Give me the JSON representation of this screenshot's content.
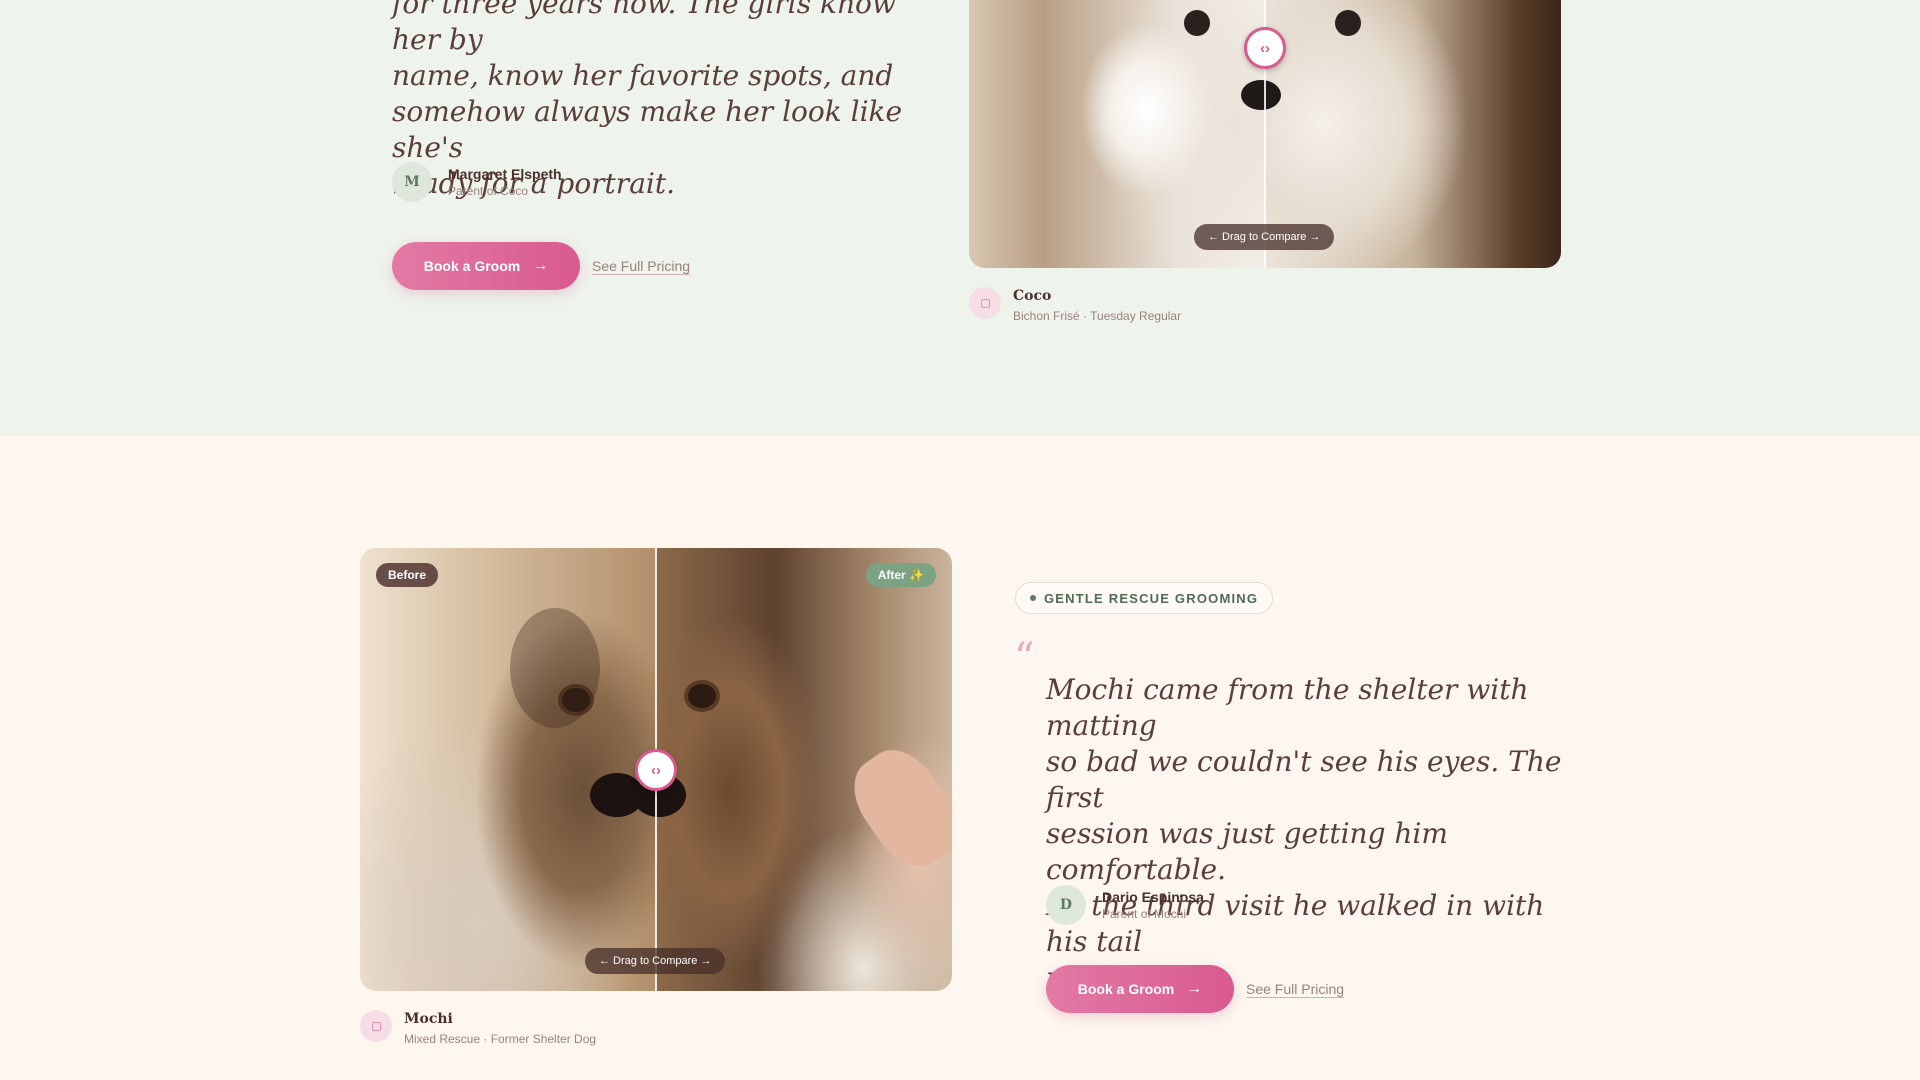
{
  "top": {
    "quote_lines": [
      "for three years now. The girls know her by",
      "name, know her favorite spots, and",
      "somehow always make her look like she's",
      "ready for a portrait."
    ],
    "author": {
      "initial": "M",
      "name": "Margaret Elspeth",
      "role": "Parent of Coco"
    },
    "cta": {
      "book_label": "Book a Groom",
      "pricing_label": "See Full Pricing"
    },
    "compare": {
      "drag_label": "← Drag to Compare →",
      "handle_glyph": "‹›"
    },
    "pet": {
      "name": "Coco",
      "sub": "Bichon Frisé · Tuesday Regular"
    }
  },
  "bottom": {
    "tag": "GENTLE RESCUE GROOMING",
    "quote_mark": "“",
    "quote_lines": [
      "Mochi came from the shelter with matting",
      "so bad we couldn't see his eyes. The first",
      "session was just getting him comfortable.",
      "By the third visit he walked in with his tail",
      "up. I cried."
    ],
    "author": {
      "initial": "D",
      "name": "Dario Espinosa",
      "role": "Parent of Mochi"
    },
    "cta": {
      "book_label": "Book a Groom",
      "pricing_label": "See Full Pricing"
    },
    "compare": {
      "before_label": "Before",
      "after_label": "After ✨",
      "drag_label": "← Drag to Compare →",
      "handle_glyph": "‹›"
    },
    "pet": {
      "name": "Mochi",
      "sub": "Mixed Rescue · Former Shelter Dog"
    }
  },
  "colors": {
    "accent_pink": "#d95a8e",
    "sage": "#5f7a64",
    "top_bg": "#eef3ec",
    "bottom_bg": "#fdf7f0"
  },
  "icons": [
    "arrow-right-icon",
    "compare-handle-icon",
    "paw-icon",
    "sparkle-icon"
  ]
}
